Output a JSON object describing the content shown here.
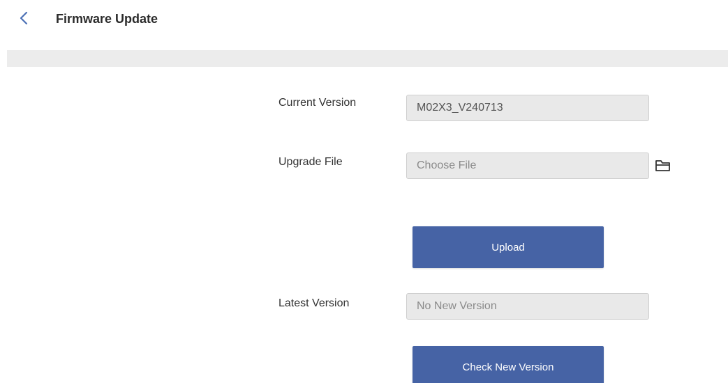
{
  "header": {
    "back_icon": "chevron-left-icon",
    "title": "Firmware Update"
  },
  "form": {
    "current_version": {
      "label": "Current Version",
      "value": "M02X3_V240713"
    },
    "upgrade_file": {
      "label": "Upgrade File",
      "placeholder": "Choose File",
      "icon": "folder-icon"
    },
    "upload_button_label": "Upload",
    "latest_version": {
      "label": "Latest Version",
      "value": "No New Version"
    },
    "check_button_label": "Check New Version"
  },
  "colors": {
    "accent": "#4663a5",
    "back_arrow": "#4a6fb5",
    "field_bg": "#e9e9e9",
    "band_bg": "#ececec"
  }
}
